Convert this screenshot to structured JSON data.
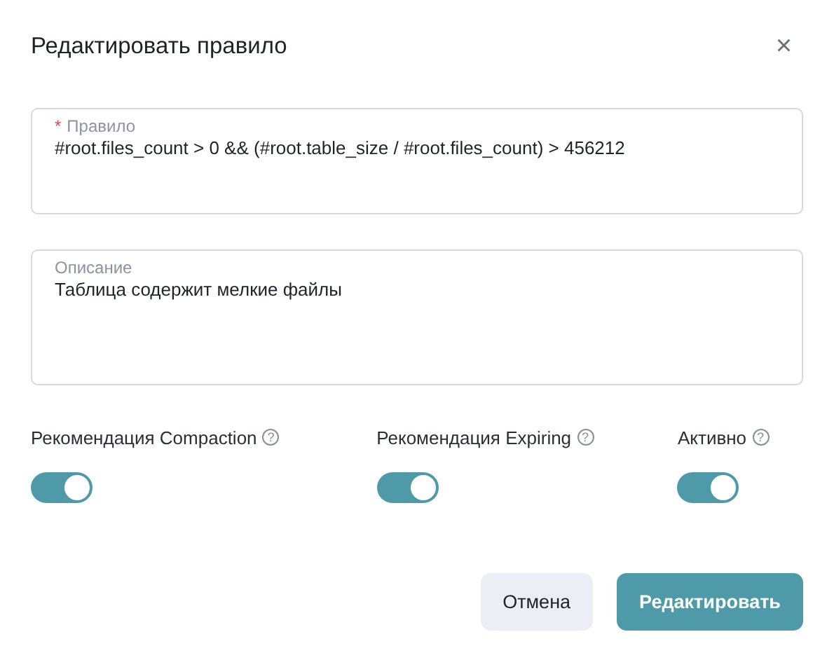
{
  "dialog": {
    "title": "Редактировать правило",
    "close": "×"
  },
  "fields": [
    {
      "label": "Правило",
      "required_mark": "*",
      "value": "#root.files_count > 0 && (#root.table_size / #root.files_count) > 456212"
    },
    {
      "label": "Описание",
      "value": "Таблица содержит мелкие файлы"
    }
  ],
  "toggles": [
    {
      "label": "Рекомендация Compaction",
      "help": "?",
      "on": true
    },
    {
      "label": "Рекомендация Expiring",
      "help": "?",
      "on": true
    },
    {
      "label": "Активно",
      "help": "?",
      "on": true
    }
  ],
  "buttons": [
    {
      "label": "Отмена",
      "kind": "secondary"
    },
    {
      "label": "Редактировать",
      "kind": "primary"
    }
  ]
}
